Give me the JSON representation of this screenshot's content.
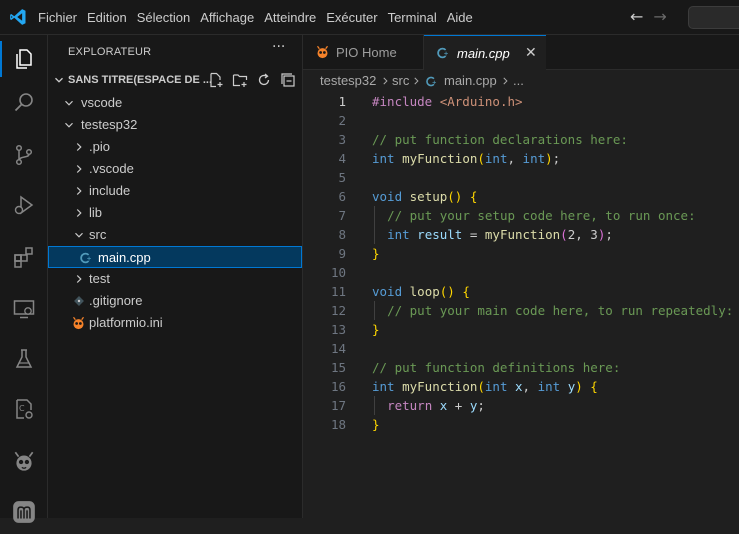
{
  "menu": [
    "Fichier",
    "Edition",
    "Sélection",
    "Affichage",
    "Atteindre",
    "Exécuter",
    "Terminal",
    "Aide"
  ],
  "colors": {
    "accent": "#0078d4",
    "brand": "#23a7f2",
    "platformio": "#f5822a",
    "selection": "#04395e"
  },
  "activity_icons": [
    "files-icon",
    "search-icon",
    "source-control-icon",
    "run-debug-icon",
    "extensions-icon",
    "remote-explorer-icon",
    "testing-icon",
    "project-manager-icon",
    "platformio-icon",
    "mbed-icon"
  ],
  "sidebar": {
    "header": "EXPLORATEUR",
    "more": "···",
    "section_title": "SANS TITRE(ESPACE DE ...",
    "tree": [
      {
        "label": "vscode",
        "type": "folder",
        "expanded": true,
        "depth": 1
      },
      {
        "label": "testesp32",
        "type": "folder",
        "expanded": true,
        "depth": 1
      },
      {
        "label": ".pio",
        "type": "folder",
        "expanded": false,
        "depth": 2
      },
      {
        "label": ".vscode",
        "type": "folder",
        "expanded": false,
        "depth": 2
      },
      {
        "label": "include",
        "type": "folder",
        "expanded": false,
        "depth": 2
      },
      {
        "label": "lib",
        "type": "folder",
        "expanded": false,
        "depth": 2
      },
      {
        "label": "src",
        "type": "folder",
        "expanded": true,
        "depth": 2
      },
      {
        "label": "main.cpp",
        "type": "cpp",
        "depth": 3,
        "selected": true
      },
      {
        "label": "test",
        "type": "folder",
        "expanded": false,
        "depth": 2
      },
      {
        "label": ".gitignore",
        "type": "git",
        "depth": 2
      },
      {
        "label": "platformio.ini",
        "type": "pio",
        "depth": 2
      }
    ]
  },
  "tabs": [
    {
      "label": "PIO Home",
      "active": false,
      "icon": "platformio-icon"
    },
    {
      "label": "main.cpp",
      "active": true,
      "icon": "cpp-icon",
      "close": "✕"
    }
  ],
  "breadcrumb": [
    "testesp32",
    "src",
    "main.cpp",
    "..."
  ],
  "editor": {
    "current_line": 1,
    "lines": [
      [
        [
          "kw2",
          "#include "
        ],
        [
          "st",
          "<Arduino.h>"
        ]
      ],
      [],
      [
        [
          "cm",
          "// put function declarations here:"
        ]
      ],
      [
        [
          "kw",
          "int "
        ],
        [
          "fn",
          "myFunction"
        ],
        [
          "br",
          "("
        ],
        [
          "kw",
          "int"
        ],
        [
          "",
          ","
        ],
        [
          "kw",
          " int"
        ],
        [
          "br",
          ")"
        ],
        [
          "",
          ";"
        ]
      ],
      [],
      [
        [
          "kw",
          "void "
        ],
        [
          "fn",
          "setup"
        ],
        [
          "br",
          "()"
        ],
        [
          "",
          ""
        ],
        [
          "br",
          " {"
        ]
      ],
      [
        [
          "",
          "  "
        ],
        [
          "cm",
          "// put your setup code here, to run once:"
        ]
      ],
      [
        [
          "",
          "  "
        ],
        [
          "kw",
          "int "
        ],
        [
          "var",
          "result"
        ],
        [
          "",
          " = "
        ],
        [
          "fn",
          "myFunction"
        ],
        [
          "br2",
          "("
        ],
        [
          "",
          "2, 3"
        ],
        [
          "br2",
          ")"
        ],
        [
          "",
          ";"
        ]
      ],
      [
        [
          "br",
          "}"
        ]
      ],
      [],
      [
        [
          "kw",
          "void "
        ],
        [
          "fn",
          "loop"
        ],
        [
          "br",
          "()"
        ],
        [
          "br",
          " {"
        ]
      ],
      [
        [
          "",
          "  "
        ],
        [
          "cm",
          "// put your main code here, to run repeatedly:"
        ]
      ],
      [
        [
          "br",
          "}"
        ]
      ],
      [],
      [
        [
          "cm",
          "// put function definitions here:"
        ]
      ],
      [
        [
          "kw",
          "int "
        ],
        [
          "fn",
          "myFunction"
        ],
        [
          "br",
          "("
        ],
        [
          "kw",
          "int "
        ],
        [
          "var",
          "x"
        ],
        [
          "",
          ", "
        ],
        [
          "kw",
          "int "
        ],
        [
          "var",
          "y"
        ],
        [
          "br",
          ")"
        ],
        [
          "br",
          " {"
        ]
      ],
      [
        [
          "",
          "  "
        ],
        [
          "kw2",
          "return "
        ],
        [
          "var",
          "x"
        ],
        [
          "",
          " + "
        ],
        [
          "var",
          "y"
        ],
        [
          "",
          ";"
        ]
      ],
      [
        [
          "br",
          "}"
        ]
      ]
    ]
  }
}
